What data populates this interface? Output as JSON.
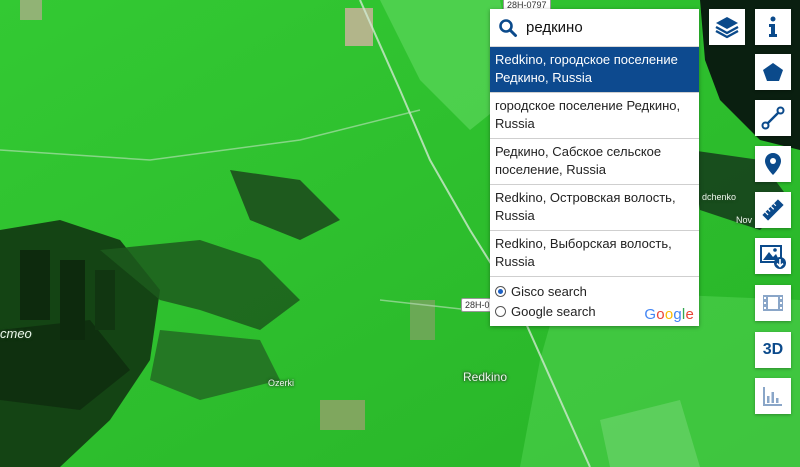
{
  "search": {
    "query": "редкино",
    "results": [
      {
        "label": "Redkino, городское поселение Редкино, Russia",
        "selected": true
      },
      {
        "label": "городское поселение Редкино, Russia",
        "selected": false
      },
      {
        "label": "Редкино, Сабское сельское поселение, Russia",
        "selected": false
      },
      {
        "label": "Redkino, Островская волость, Russia",
        "selected": false
      },
      {
        "label": "Redkino, Выборская волость, Russia",
        "selected": false
      }
    ],
    "sources": [
      {
        "label": "Gisco search",
        "checked": true
      },
      {
        "label": "Google search",
        "checked": false
      }
    ],
    "google_logo_letters": [
      "G",
      "o",
      "o",
      "g",
      "l",
      "e"
    ],
    "google_colors": [
      "#4285F4",
      "#EA4335",
      "#FBBC05",
      "#4285F4",
      "#34A853",
      "#EA4335"
    ]
  },
  "toolbar": {
    "buttons": [
      {
        "name": "layers-button",
        "icon": "layers-icon"
      },
      {
        "name": "info-button",
        "icon": "info-icon"
      },
      {
        "name": "draw-polygon-button",
        "icon": "pentagon-icon"
      },
      {
        "name": "draw-line-button",
        "icon": "line-icon"
      },
      {
        "name": "place-marker-button",
        "icon": "map-marker-icon"
      },
      {
        "name": "measure-button",
        "icon": "ruler-icon"
      },
      {
        "name": "download-image-button",
        "icon": "image-download-icon"
      },
      {
        "name": "timelapse-button",
        "icon": "film-icon"
      },
      {
        "name": "3d-button",
        "icon": "3d-icon",
        "label": "3D"
      },
      {
        "name": "statistics-button",
        "icon": "bar-chart-icon"
      }
    ],
    "accent_color": "#0b4a8b",
    "muted_color": "#8aa6c8"
  },
  "map": {
    "labels": {
      "redkino": "Redkino",
      "ozerki": "Ozerki",
      "road_top": "28H-0797",
      "road_mid": "28H-0",
      "left_edge": "стео",
      "right_top": "dchenko",
      "right_mid": "Nov"
    }
  }
}
